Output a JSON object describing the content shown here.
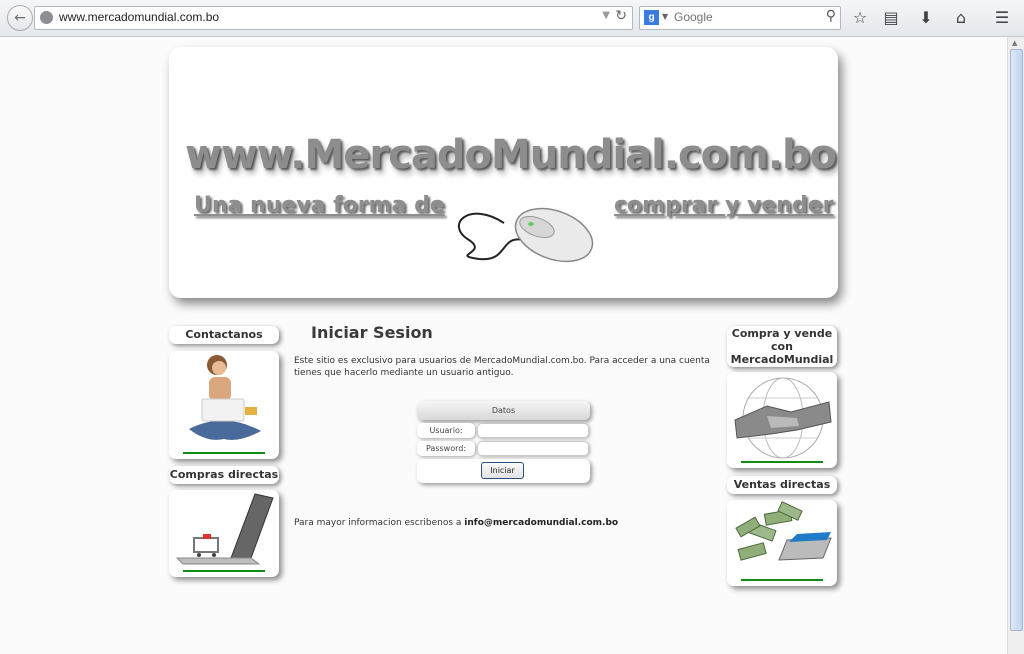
{
  "browser": {
    "url": "www.mercadomundial.com.bo",
    "search_placeholder": "Google",
    "search_engine_icon": "google-icon",
    "toolbar_icons": [
      "star-icon",
      "reading-list-icon",
      "download-icon",
      "home-icon",
      "menu-icon"
    ]
  },
  "banner": {
    "site_name": "www.MercadoMundial.com.bo",
    "slogan_left": "Una nueva forma de",
    "slogan_right": "comprar y vender",
    "image": "computer-mouse"
  },
  "left_sidebar": {
    "contact_label": "Contactanos",
    "contact_image": "woman-with-laptop",
    "direct_purchases_label": "Compras directas",
    "direct_purchases_image": "laptop-shopping-cart"
  },
  "right_sidebar": {
    "buy_sell_label_line1": "Compra y vende",
    "buy_sell_label_line2": "con",
    "buy_sell_label_line3": "MercadoMundial",
    "buy_sell_image": "handshake-globe",
    "direct_sales_label": "Ventas directas",
    "direct_sales_image": "money-from-laptop"
  },
  "main": {
    "heading": "Iniciar Sesion",
    "intro": "Este sitio es exclusivo para usuarios de MercadoMundial.com.bo. Para acceder a una cuenta tienes que hacerlo mediante un usuario antiguo.",
    "login": {
      "header": "Datos",
      "user_label": "Usuario:",
      "password_label": "Password:",
      "submit_label": "Iniciar"
    },
    "footer_text": "Para mayor informacion escribenos a",
    "footer_email": "info@mercadomundial.com.bo"
  },
  "colors": {
    "accent_green": "#138a13",
    "button_border": "#2c4f80",
    "page_background": "#fbfbfb"
  }
}
